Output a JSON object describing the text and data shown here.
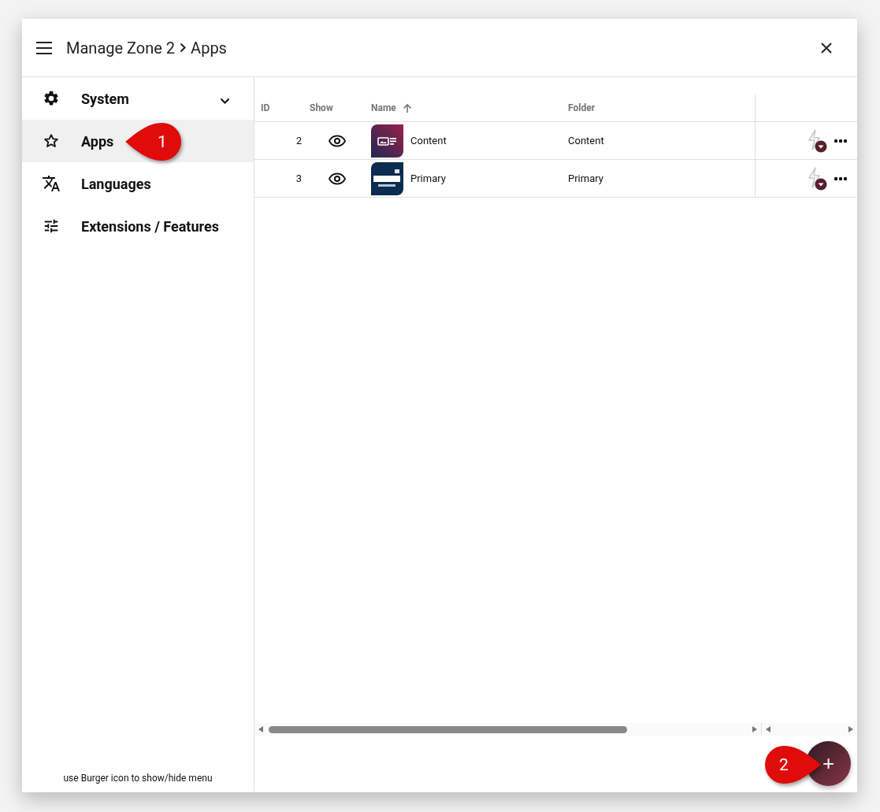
{
  "window": {
    "title": "Manage Zone 2",
    "subtitle": "Apps"
  },
  "sidebar": {
    "items": [
      {
        "label": "System",
        "selected": false,
        "expanded": false
      },
      {
        "label": "Apps",
        "selected": true
      },
      {
        "label": "Languages",
        "selected": false
      },
      {
        "label": "Extensions / Features",
        "selected": false
      }
    ],
    "footer": "use Burger icon to show/hide menu"
  },
  "table": {
    "columns": [
      {
        "label": "ID",
        "sorted": false
      },
      {
        "label": "Show",
        "sorted": false
      },
      {
        "label": "Name",
        "sorted": true
      },
      {
        "label": "Folder",
        "sorted": false
      }
    ],
    "rows": [
      {
        "id": "2",
        "visible": true,
        "name": "Content",
        "folder": "Content"
      },
      {
        "id": "3",
        "visible": true,
        "name": "Primary",
        "folder": "Primary"
      }
    ]
  },
  "fab": {
    "label": "+"
  },
  "callouts": [
    {
      "number": "1"
    },
    {
      "number": "2"
    }
  ]
}
